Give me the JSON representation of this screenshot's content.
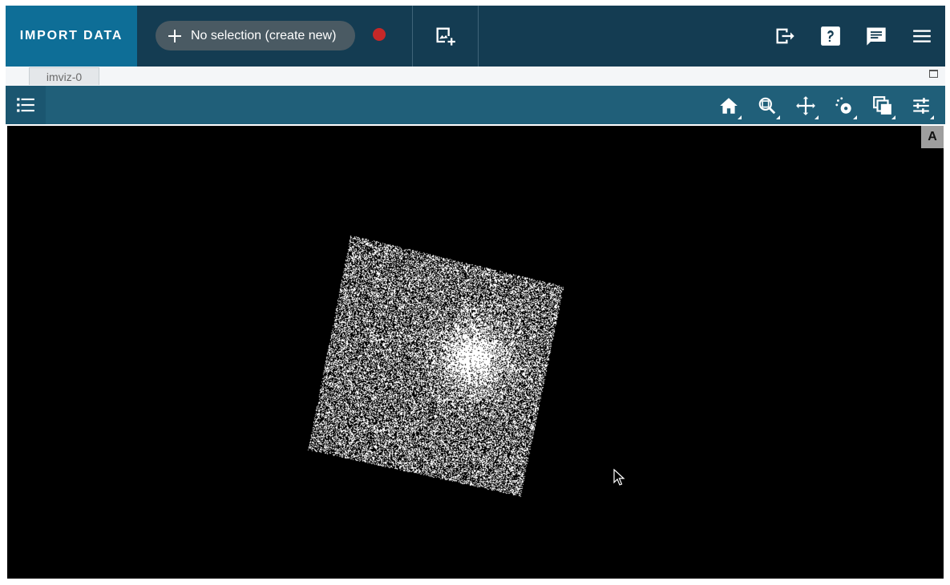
{
  "topbar": {
    "import_label": "IMPORT DATA",
    "subset_label": "No selection (create new)",
    "icons": [
      "add-icon",
      "record-dot",
      "new-image-viewer-icon",
      "export-icon",
      "help-icon",
      "chat-icon",
      "menu-icon"
    ]
  },
  "tabs": [
    {
      "label": "imviz-0"
    }
  ],
  "viewer_toolbar": {
    "icons": [
      "list-icon",
      "home-icon",
      "zoom-icon",
      "pan-icon",
      "spectral-extraction-icon",
      "layers-icon",
      "sliders-icon"
    ]
  },
  "viewer": {
    "badge": "A",
    "colors": {
      "background": "#000000",
      "pixels": "#ffffff"
    }
  },
  "colors": {
    "topbar": "#143c52",
    "import": "#0e6e97",
    "toolbar": "#205f79",
    "record": "#c62828"
  }
}
